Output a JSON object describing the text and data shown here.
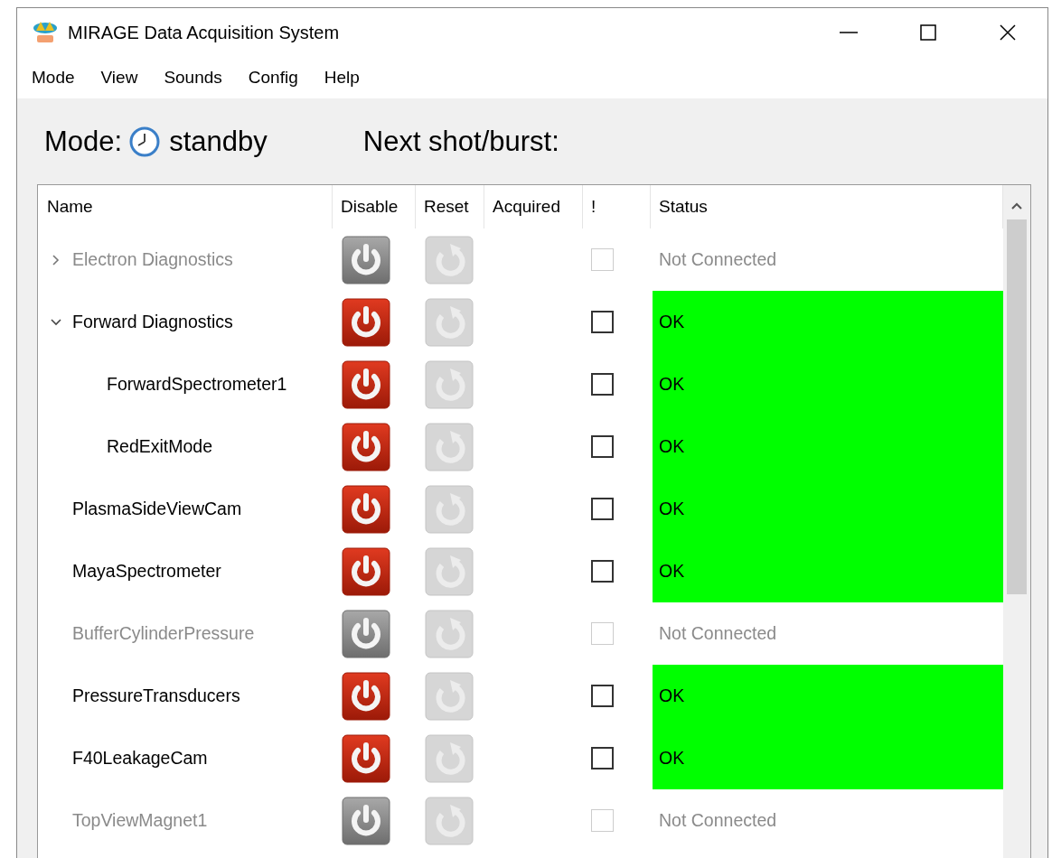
{
  "window": {
    "title": "MIRAGE Data Acquisition System"
  },
  "menu": [
    "Mode",
    "View",
    "Sounds",
    "Config",
    "Help"
  ],
  "mode": {
    "label": "Mode:",
    "value": "standby",
    "next_label": "Next shot/burst:"
  },
  "table": {
    "columns": [
      "Name",
      "Disable",
      "Reset",
      "Acquired",
      "!",
      "Status"
    ],
    "rows": [
      {
        "name": "Electron Diagnostics",
        "connected": false,
        "expanded": false,
        "checked": false,
        "status": "Not Connected"
      },
      {
        "name": "Forward Diagnostics",
        "connected": true,
        "expanded": true,
        "checked": false,
        "status": "OK",
        "children": [
          {
            "name": "ForwardSpectrometer1",
            "connected": true,
            "checked": false,
            "status": "OK"
          },
          {
            "name": "RedExitMode",
            "connected": true,
            "checked": false,
            "status": "OK"
          }
        ]
      },
      {
        "name": "PlasmaSideViewCam",
        "connected": true,
        "checked": false,
        "status": "OK"
      },
      {
        "name": "MayaSpectrometer",
        "connected": true,
        "checked": false,
        "status": "OK"
      },
      {
        "name": "BufferCylinderPressure",
        "connected": false,
        "checked": false,
        "status": "Not Connected"
      },
      {
        "name": "PressureTransducers",
        "connected": true,
        "checked": false,
        "status": "OK"
      },
      {
        "name": "F40LeakageCam",
        "connected": true,
        "checked": false,
        "status": "OK"
      },
      {
        "name": "TopViewMagnet1",
        "connected": false,
        "checked": false,
        "status": "Not Connected"
      }
    ]
  }
}
